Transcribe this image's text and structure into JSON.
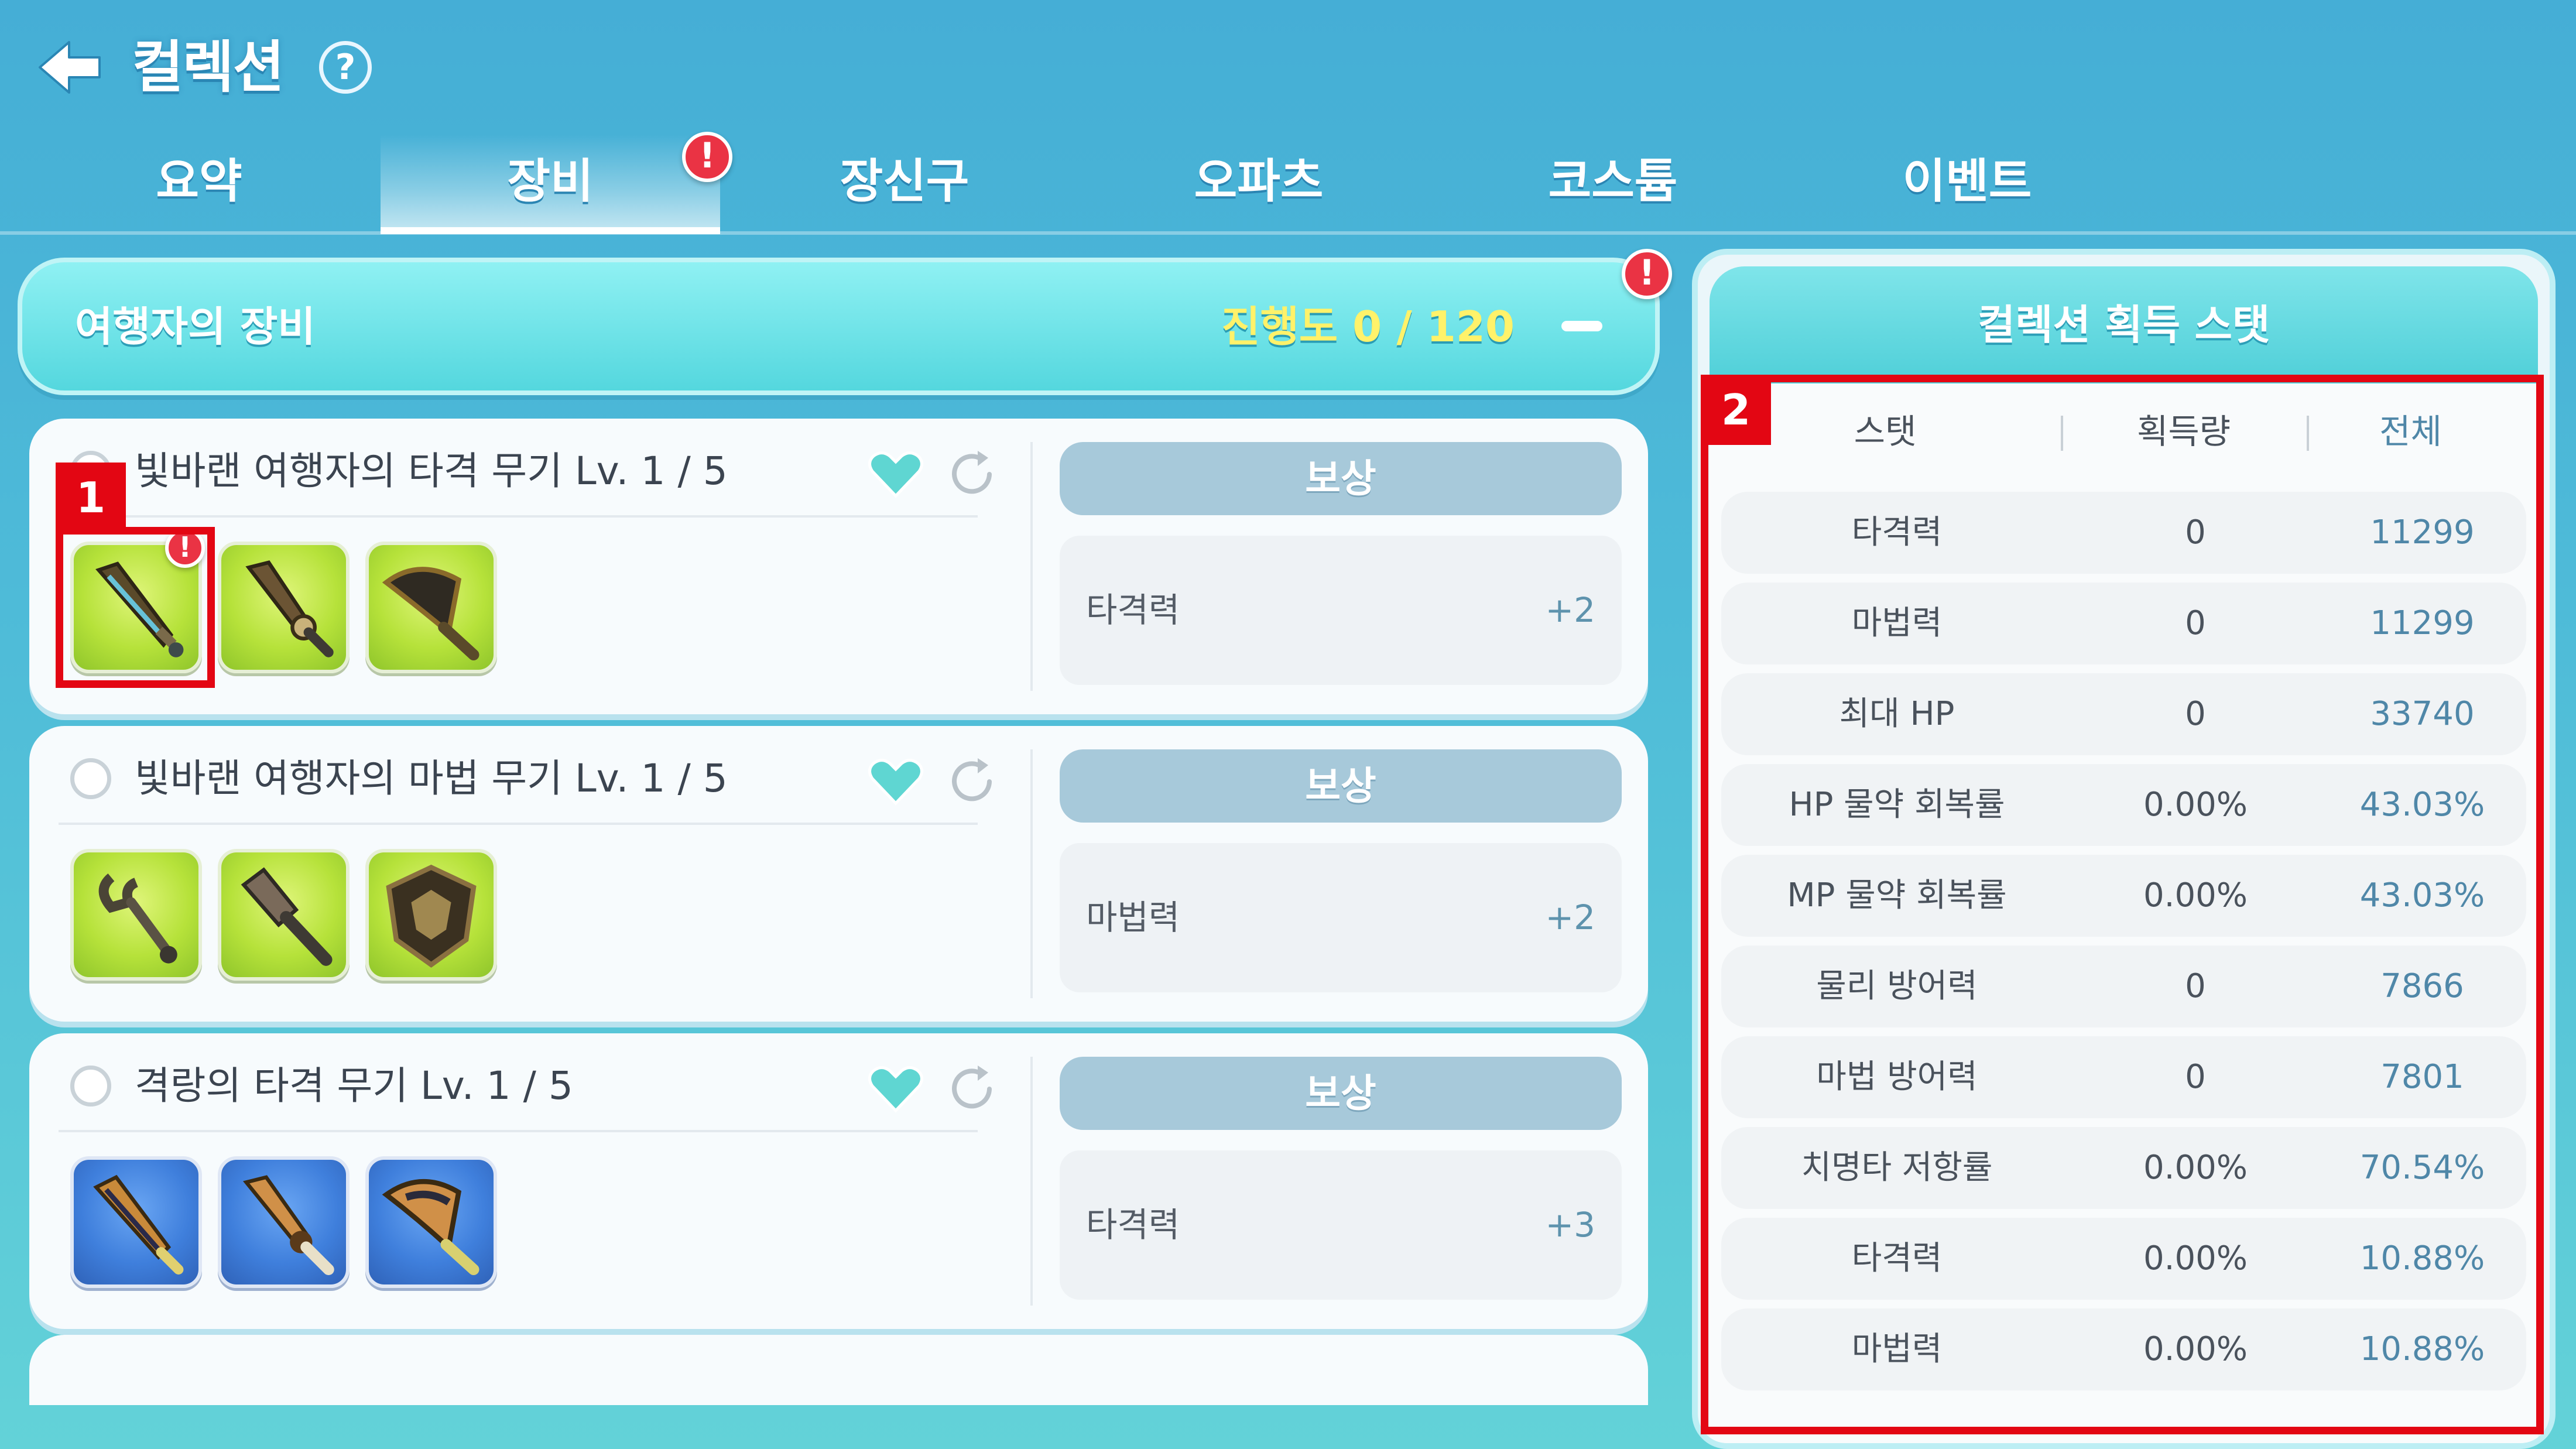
{
  "header": {
    "title": "컬렉션",
    "help_icon": "?"
  },
  "tabs": [
    {
      "label": "요약"
    },
    {
      "label": "장비",
      "active": true,
      "alert": "!"
    },
    {
      "label": "장신구"
    },
    {
      "label": "오파츠"
    },
    {
      "label": "코스튬"
    },
    {
      "label": "이벤트"
    }
  ],
  "panel": {
    "title": "여행자의 장비",
    "progress": "진행도 0 / 120",
    "alert": "!"
  },
  "cards": [
    {
      "name": "빛바랜 여행자의 타격 무기 Lv. 1 / 5",
      "reward_button": "보상",
      "reward_stat": "타격력",
      "reward_value": "+2",
      "slot_color": "green",
      "first_slot_alert": "!"
    },
    {
      "name": "빛바랜 여행자의 마법 무기 Lv. 1 / 5",
      "reward_button": "보상",
      "reward_stat": "마법력",
      "reward_value": "+2",
      "slot_color": "green"
    },
    {
      "name": "격랑의 타격 무기 Lv. 1 / 5",
      "reward_button": "보상",
      "reward_stat": "타격력",
      "reward_value": "+3",
      "slot_color": "blue"
    }
  ],
  "stats_panel": {
    "title": "컬렉션 획득 스탯",
    "columns": [
      "스탯",
      "획득량",
      "전체"
    ],
    "rows": [
      {
        "stat": "타격력",
        "acquired": "0",
        "total": "11299"
      },
      {
        "stat": "마법력",
        "acquired": "0",
        "total": "11299"
      },
      {
        "stat": "최대 HP",
        "acquired": "0",
        "total": "33740"
      },
      {
        "stat": "HP 물약 회복률",
        "acquired": "0.00%",
        "total": "43.03%"
      },
      {
        "stat": "MP 물약 회복률",
        "acquired": "0.00%",
        "total": "43.03%"
      },
      {
        "stat": "물리 방어력",
        "acquired": "0",
        "total": "7866"
      },
      {
        "stat": "마법 방어력",
        "acquired": "0",
        "total": "7801"
      },
      {
        "stat": "치명타 저항률",
        "acquired": "0.00%",
        "total": "70.54%"
      },
      {
        "stat": "타격력",
        "acquired": "0.00%",
        "total": "10.88%"
      },
      {
        "stat": "마법력",
        "acquired": "0.00%",
        "total": "10.88%"
      }
    ]
  },
  "annotations": [
    {
      "label": "1"
    },
    {
      "label": "2"
    }
  ],
  "colors": {
    "accent_red": "#e30613",
    "alert_red": "#ea3344",
    "progress_yellow": "#fff26a",
    "stat_blue": "#4f87a8"
  }
}
